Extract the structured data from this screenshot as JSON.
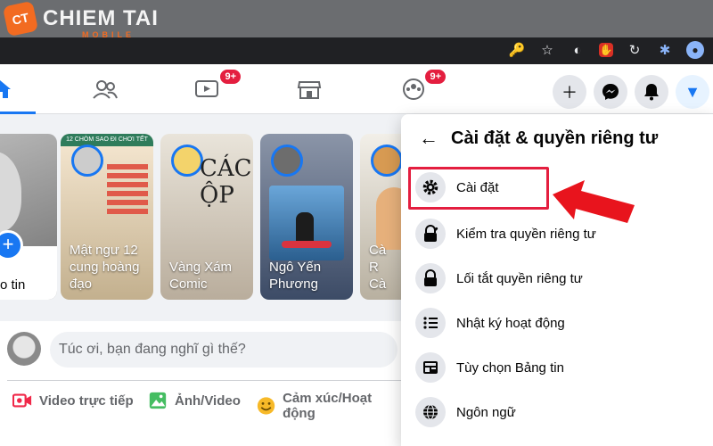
{
  "watermark": {
    "badge": "CT",
    "brand": "CHIEM TAI",
    "sub": "MOBILE"
  },
  "nav": {
    "tabs": [
      {
        "name": "home",
        "badge": ""
      },
      {
        "name": "friends",
        "badge": ""
      },
      {
        "name": "watch",
        "badge": "9+"
      },
      {
        "name": "marketplace",
        "badge": ""
      },
      {
        "name": "groups",
        "badge": "9+"
      }
    ]
  },
  "stories": [
    {
      "caption": "o tin"
    },
    {
      "caption": "Mật ngư 12 cung hoàng đạo",
      "overlay": "12 CHÒM SAO ĐI CHƠI TẾT"
    },
    {
      "caption": "Vàng Xám Comic",
      "overlay": "CÁCH ỘP"
    },
    {
      "caption": "Ngô Yến Phương",
      "overlay": ""
    },
    {
      "caption": "Cà R Cà",
      "overlay": ""
    }
  ],
  "composer": {
    "prompt": "Túc ơi, bạn đang nghĩ gì thế?",
    "actions": [
      "Video trực tiếp",
      "Ảnh/Video",
      "Cảm xúc/Hoạt động"
    ]
  },
  "panel": {
    "title": "Cài đặt & quyền riêng tư",
    "items": [
      {
        "label": "Cài đặt",
        "icon": "gear-icon"
      },
      {
        "label": "Kiểm tra quyền riêng tư",
        "icon": "lock-heart-icon"
      },
      {
        "label": "Lối tắt quyền riêng tư",
        "icon": "lock-icon"
      },
      {
        "label": "Nhật ký hoạt động",
        "icon": "list-icon"
      },
      {
        "label": "Tùy chọn Bảng tin",
        "icon": "news-feed-icon"
      },
      {
        "label": "Ngôn ngữ",
        "icon": "globe-icon"
      }
    ]
  },
  "colors": {
    "fb_blue": "#1877f2",
    "highlight_red": "#e41e3f",
    "brand_orange": "#f26b21"
  }
}
